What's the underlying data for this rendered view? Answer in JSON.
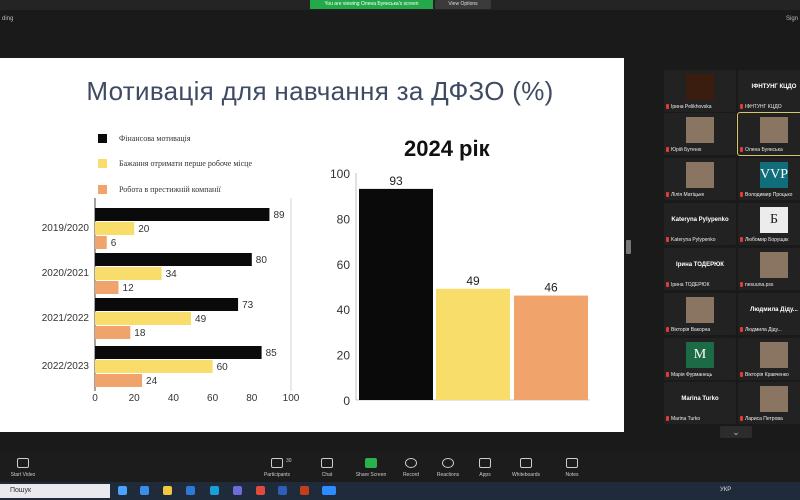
{
  "zoom": {
    "viewing_banner": "You are viewing Олена Буянська's screen",
    "view_options": "View Options",
    "top_left_label": "ding",
    "top_right_label": "Sign"
  },
  "slide": {
    "title": "Мотивація для навчання за ДФЗО (%)",
    "left_chart": {
      "legend": [
        {
          "label": "Фінансова мотивація",
          "color": "#0a0a0a"
        },
        {
          "label": "Бажання отримати перше робоче місце",
          "color": "#f9dd6b"
        },
        {
          "label": "Робота в престижній компанії",
          "color": "#f0a36a"
        }
      ],
      "x_ticks": [
        "0",
        "20",
        "40",
        "60",
        "80",
        "100"
      ]
    },
    "right_chart": {
      "title": "2024 рік",
      "y_ticks": [
        "0",
        "20",
        "40",
        "60",
        "80",
        "100"
      ]
    }
  },
  "chart_data": [
    {
      "type": "bar",
      "orientation": "horizontal",
      "categories": [
        "2019/2020",
        "2020/2021",
        "2021/2022",
        "2022/2023"
      ],
      "series": [
        {
          "name": "Фінансова мотивація",
          "values": [
            89,
            80,
            73,
            85
          ],
          "color": "#0a0a0a"
        },
        {
          "name": "Бажання отримати перше робоче місце",
          "values": [
            20,
            34,
            49,
            60
          ],
          "color": "#f9dd6b"
        },
        {
          "name": "Робота в престижній компанії",
          "values": [
            6,
            12,
            18,
            24
          ],
          "color": "#f0a36a"
        }
      ],
      "xlim": [
        0,
        100
      ],
      "grid": false,
      "legend_position": "top-left"
    },
    {
      "type": "bar",
      "title": "2024 рік",
      "values": [
        93,
        49,
        46
      ],
      "colors": [
        "#0a0a0a",
        "#f9dd6b",
        "#f0a36a"
      ],
      "ylim": [
        0,
        100
      ],
      "grid": false
    }
  ],
  "gallery": [
    {
      "name": "Ірина Pelikhovska",
      "center": "",
      "avatar": "candle"
    },
    {
      "name": "ІФНТУНГ КЦДО",
      "center": "ІФНТУНГ КЦДО",
      "avatar": ""
    },
    {
      "name": "Юрій Бутеню",
      "center": "",
      "avatar": "person"
    },
    {
      "name": "Олена Буянська",
      "center": "",
      "avatar": "person",
      "selected": true
    },
    {
      "name": "Лілія Матіцьке",
      "center": "",
      "avatar": "person"
    },
    {
      "name": "Володимир Процько",
      "center": "",
      "avatar": "VVP"
    },
    {
      "name": "Kateryna Pylypenko",
      "center": "Kateryna Pylypenko",
      "avatar": ""
    },
    {
      "name": "Любомир Борущак",
      "center": "",
      "avatar": "Б"
    },
    {
      "name": "Ірина ТОДЕРЮК",
      "center": "Ірина ТОДЕРЮК",
      "avatar": ""
    },
    {
      "name": "nesuuna.pss",
      "center": "",
      "avatar": "person"
    },
    {
      "name": "Вікторія Вакорна",
      "center": "",
      "avatar": "person"
    },
    {
      "name": "Людмила Діду...",
      "center": "Людмила Діду...",
      "avatar": ""
    },
    {
      "name": "Марія Фурманець",
      "center": "",
      "avatar": "M"
    },
    {
      "name": "Вікторія Кравченко",
      "center": "",
      "avatar": "person"
    },
    {
      "name": "Marina Turko",
      "center": "Marina Turko",
      "avatar": ""
    },
    {
      "name": "Лариса Петрова",
      "center": "",
      "avatar": "person"
    }
  ],
  "toolbar": {
    "start_video": "Start Video",
    "participants": "Participants",
    "participants_count": "30",
    "chat": "Chat",
    "share_screen": "Share Screen",
    "record": "Record",
    "reactions": "Reactions",
    "apps": "Apps",
    "whiteboards": "Whiteboards",
    "notes": "Notes"
  },
  "taskbar": {
    "search_placeholder": "Пошук",
    "tray": "УКР"
  }
}
